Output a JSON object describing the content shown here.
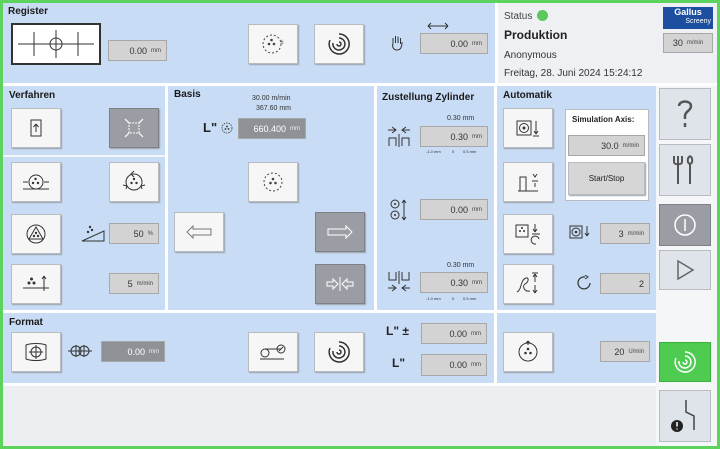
{
  "register": {
    "title": "Register",
    "offset_value": "0.00",
    "offset_unit": "mm",
    "register_value": "0.00",
    "register_unit": "mm"
  },
  "status": {
    "label": "Status",
    "mode": "Produktion",
    "user": "Anonymous",
    "datetime": "Freitag, 28. Juni 2024 15:24:12",
    "logo_line1": "Gallus",
    "logo_line2": "Screeny",
    "speed_value": "30",
    "speed_unit": "m/min"
  },
  "verfahren": {
    "title": "Verfahren",
    "ramp_value": "50",
    "ramp_unit": "%",
    "speed_value": "5",
    "speed_unit": "m/min"
  },
  "basis": {
    "title": "Basis",
    "speed_line1": "30.00  m/min",
    "speed_line2": "367.60  mm",
    "length_label": "L\"",
    "length_value": "660.400",
    "length_unit": "mm"
  },
  "zustellung": {
    "title": "Zustellung Zylinder",
    "top_small": "0.30  mm",
    "top_value": "0.30",
    "top_unit": "mm",
    "top_scale": [
      "-1.0  mm",
      "0",
      "0.5  mm"
    ],
    "mid_value": "0.00",
    "mid_unit": "mm",
    "bot_small": "0.30  mm",
    "bot_value": "0.30",
    "bot_unit": "mm",
    "bot_scale": [
      "-1.0  mm",
      "0",
      "0.5  mm"
    ]
  },
  "automatik": {
    "title": "Automatik",
    "sim_title": "Simulation Axis:",
    "sim_value": "30.0",
    "sim_unit": "m/min",
    "start_stop": "Start/Stop",
    "speed_value": "3",
    "speed_unit": "m/min",
    "count_value": "2",
    "rpm_value": "20",
    "rpm_unit": "U/min"
  },
  "format": {
    "title": "Format",
    "offset_value": "0.00",
    "offset_unit": "mm",
    "l_plus_label": "L\" ±",
    "l_plus_value": "0.00",
    "l_plus_unit": "mm",
    "l_label": "L\"",
    "l_value": "0.00",
    "l_unit": "mm"
  },
  "colors": {
    "frame": "#5cd35c",
    "panel": "#c9dcf5",
    "status_dot": "#5cc85c",
    "logo": "#1d4fa0",
    "active_button": "#4fcb52"
  },
  "icons": [
    "register-target-icon",
    "adjust-icon",
    "swirl-icon",
    "hand-icon",
    "width-arrow-icon",
    "help-icon",
    "tools-icon",
    "info-icon",
    "play-icon",
    "fault-icon"
  ]
}
